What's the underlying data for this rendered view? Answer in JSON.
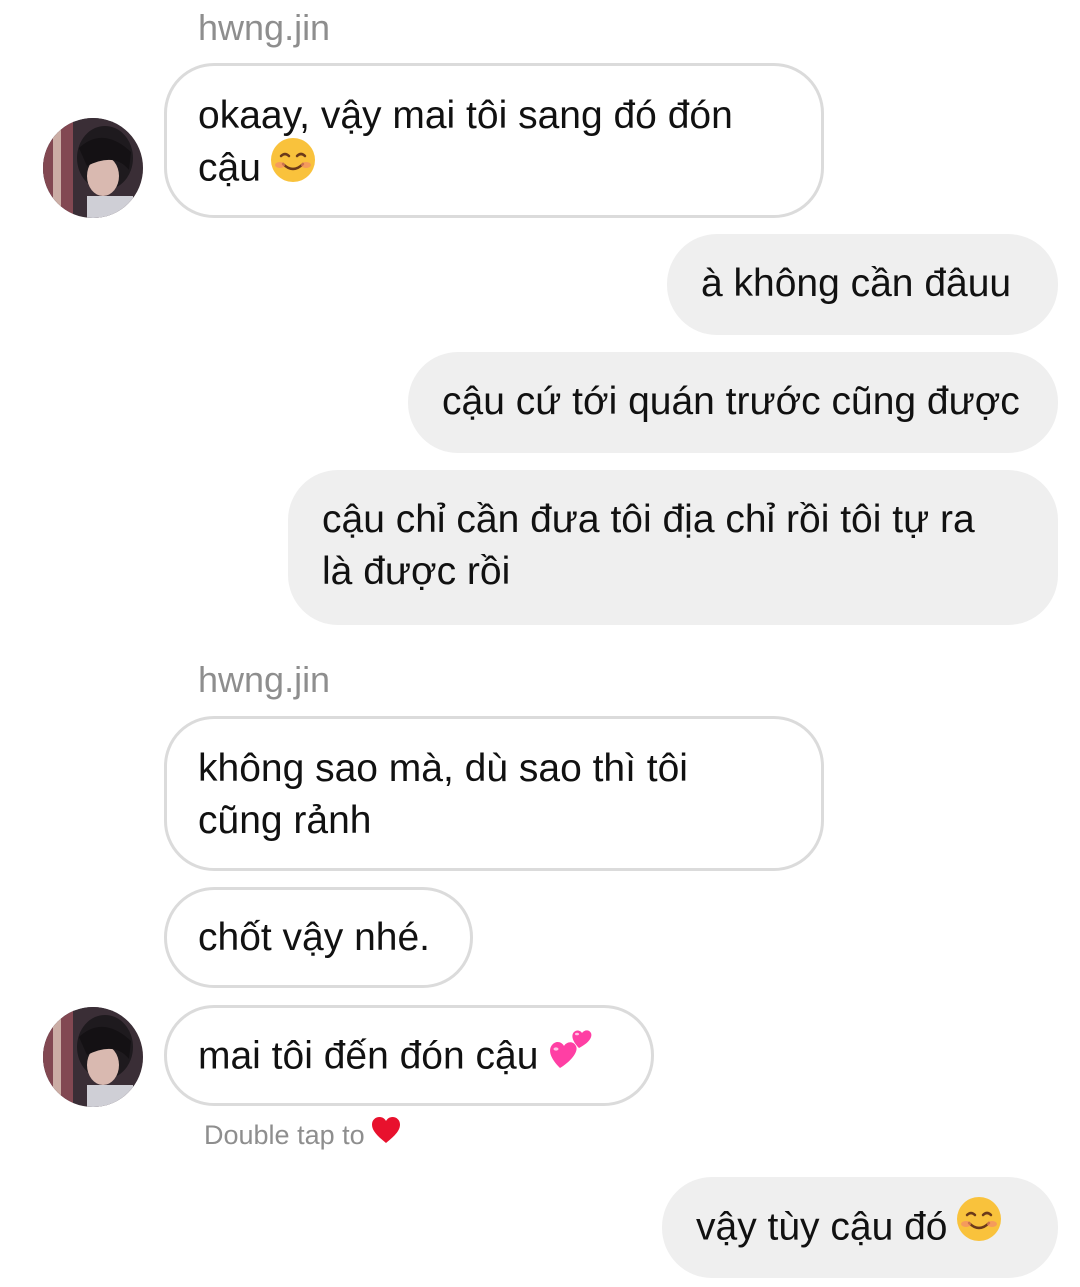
{
  "conversation": {
    "messages": [
      {
        "sender_label": "hwng.jin",
        "text": "okaay, vậy mai tôi sang đó đón",
        "text2": "cậu",
        "emoji": "smiling-face-icon"
      },
      {
        "text": "à không cần đâuu"
      },
      {
        "text": "cậu cứ tới quán trước cũng được"
      },
      {
        "text": "cậu chỉ cần đưa tôi địa chỉ rồi tôi tự ra",
        "text2": "là được rồi"
      },
      {
        "sender_label": "hwng.jin",
        "text": "không sao mà, dù sao thì tôi",
        "text2": "cũng rảnh"
      },
      {
        "text": "chốt vậy nhé."
      },
      {
        "text": "mai tôi đến đón cậu",
        "emoji": "two-hearts-icon"
      },
      {
        "text": "vậy tùy cậu đó",
        "emoji": "smiling-face-icon"
      }
    ],
    "reaction_hint": "Double tap to",
    "reaction_hint_icon": "red-heart-icon"
  },
  "colors": {
    "incoming_bubble_border": "#dbdbdb",
    "outgoing_bubble_bg": "#efefef",
    "secondary_text": "#8e8e8e",
    "heart": "#e8112d",
    "two_hearts": "#ff3fa4",
    "emoji_face": "#f9c23c"
  }
}
